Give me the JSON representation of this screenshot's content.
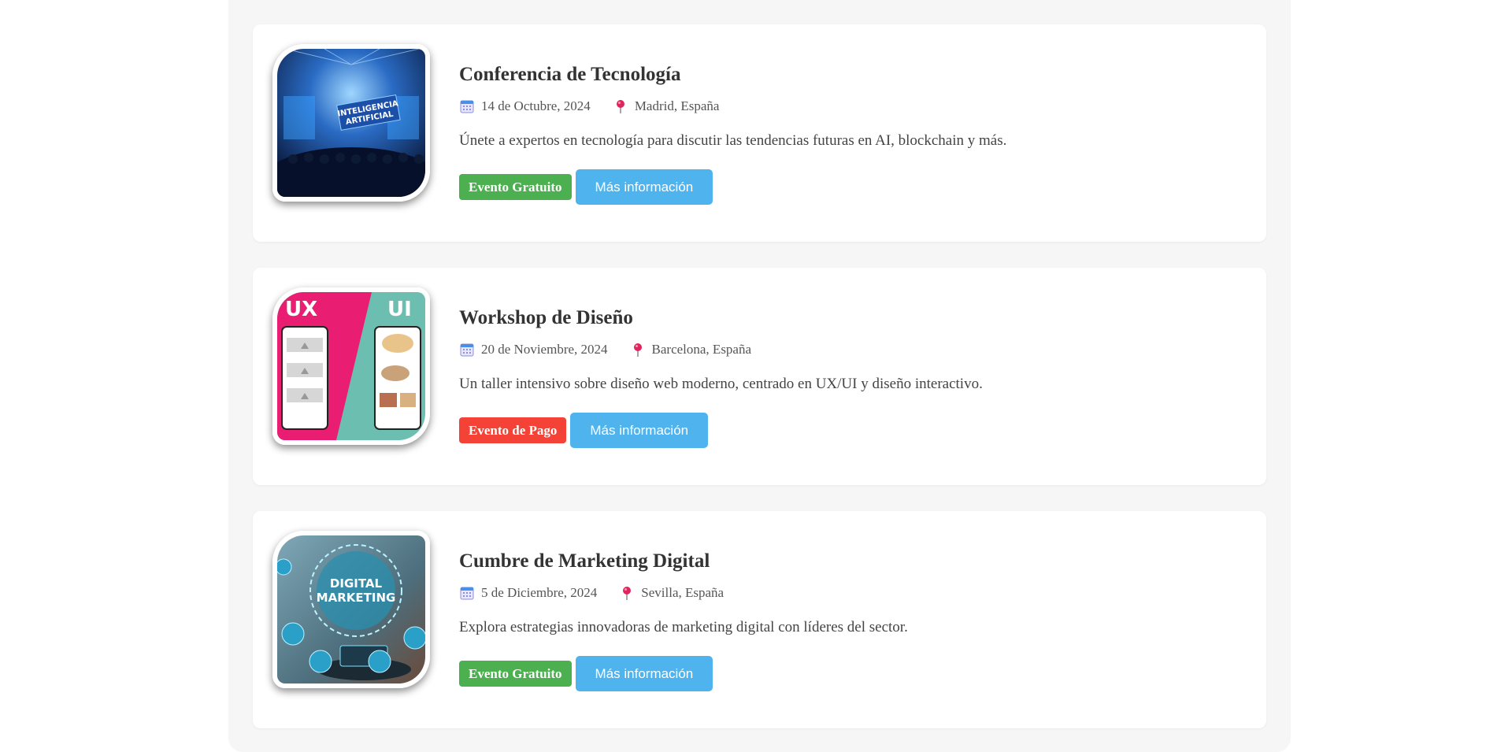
{
  "events": [
    {
      "title": "Conferencia de Tecnología",
      "date": "14 de Octubre, 2024",
      "location": "Madrid, España",
      "description": "Únete a expertos en tecnología para discutir las tendencias futuras en AI, blockchain y más.",
      "badge": "Evento Gratuito",
      "badge_color": "#4caf50",
      "button": "Más información",
      "image_text": [
        "INTELIGENCIA",
        "ARTIFICIAL"
      ]
    },
    {
      "title": "Workshop de Diseño",
      "date": "20 de Noviembre, 2024",
      "location": "Barcelona, España",
      "description": "Un taller intensivo sobre diseño web moderno, centrado en UX/UI y diseño interactivo.",
      "badge": "Evento de Pago",
      "badge_color": "#f44336",
      "button": "Más información",
      "image_text": [
        "UX",
        "UI"
      ]
    },
    {
      "title": "Cumbre de Marketing Digital",
      "date": "5 de Diciembre, 2024",
      "location": "Sevilla, España",
      "description": "Explora estrategias innovadoras de marketing digital con líderes del sector.",
      "badge": "Evento Gratuito",
      "badge_color": "#4caf50",
      "button": "Más información",
      "image_text": [
        "DIGITAL",
        "MARKETING"
      ]
    }
  ],
  "icons": {
    "date": "calendar-icon",
    "location": "pin-icon"
  },
  "colors": {
    "button": "#4fb3ee",
    "page_bg": "#f6f6f6",
    "card_bg": "#ffffff"
  }
}
